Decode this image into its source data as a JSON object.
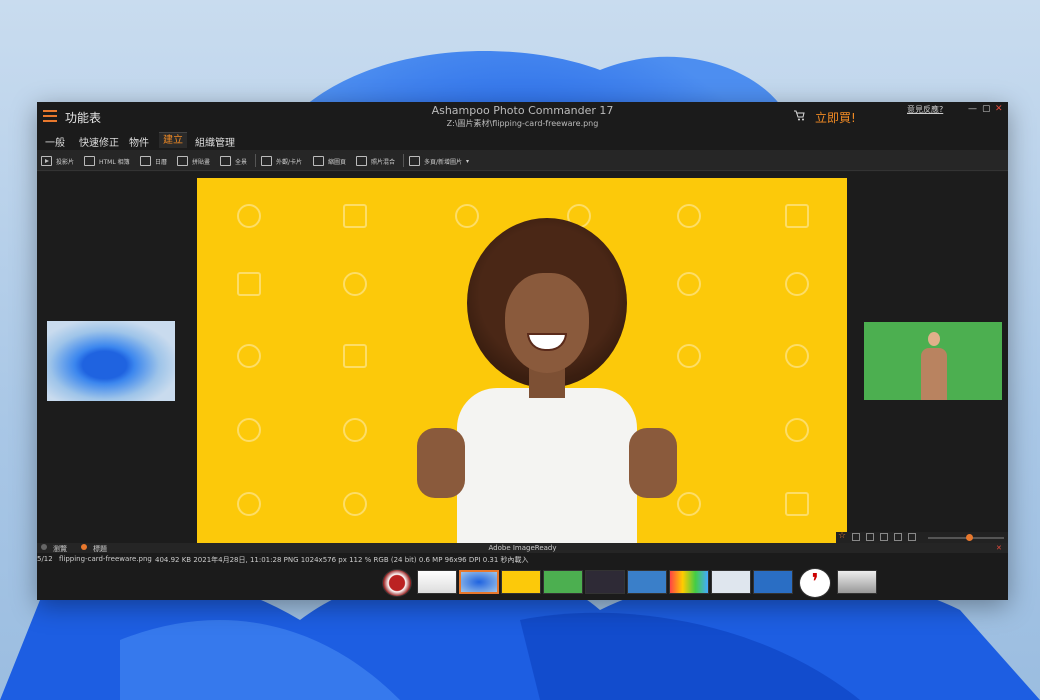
{
  "titlebar": {
    "menu_label": "功能表",
    "app_title": "Ashampoo Photo Commander 17",
    "file_path": "Z:\\圖片素材\\flipping-card-freeware.png",
    "buy_label": "立即買!",
    "feedback_label": "意見反應?",
    "minimize": "—",
    "maximize": "▢",
    "close": "✕"
  },
  "tabs": [
    {
      "label": "一般"
    },
    {
      "label": "快速修正"
    },
    {
      "label": "物件"
    },
    {
      "label": "建立",
      "active": true
    },
    {
      "label": "組織管理"
    }
  ],
  "toolbar": {
    "items": [
      {
        "label": "投影片",
        "icon": "slideshow-icon"
      },
      {
        "label": "HTML 相簿",
        "icon": "html-album-icon"
      },
      {
        "label": "日曆",
        "icon": "calendar-icon"
      },
      {
        "label": "拼貼畫",
        "icon": "collage-icon"
      },
      {
        "label": "全景",
        "icon": "panorama-icon"
      },
      {
        "label": "外觀/卡片",
        "icon": "card-icon"
      },
      {
        "label": "縮圖頁",
        "icon": "thumbnail-page-icon"
      },
      {
        "label": "照片混合",
        "icon": "photo-blend-icon"
      },
      {
        "label": "多頁/新增圖片",
        "icon": "multipage-icon"
      }
    ]
  },
  "infobar1": {
    "tab_browse": "瀏覽",
    "tab_tags": "標題",
    "center_label": "Adobe ImageReady",
    "close": "✕"
  },
  "infobar2": {
    "position": "5/12",
    "filename": "flipping-card-freeware.png",
    "details": "404.92 KB  2021年4月28日, 11:01:28  PNG  1024x576 px  112 %  RGB (24 bit)  0.6 MP  96x96 DPI  0.31 秒內載入"
  },
  "colors": {
    "accent": "#e8782d",
    "main_bg": "#fcc90a"
  }
}
